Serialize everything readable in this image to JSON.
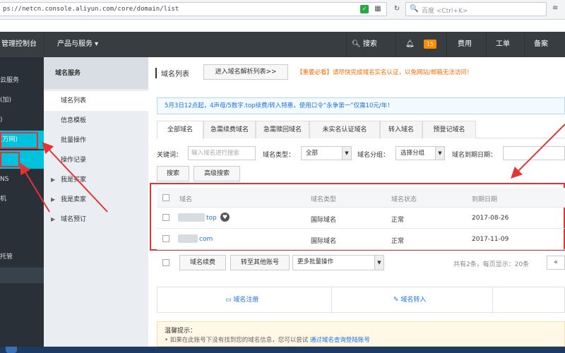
{
  "browser": {
    "url": "ps://netcn.console.aliyun.com/core/domain/list",
    "search_placeholder": "百度 <Ctrl+K>",
    "search_icon": "search-icon",
    "grid_icon": "grid-icon",
    "reload_icon": "reload-icon",
    "shield_icon": "shield-icon"
  },
  "topnav": {
    "console": "管理控制台",
    "products": "产品与服务 ▾",
    "search": "搜索",
    "badge": "15",
    "fee": "费用",
    "ticket": "工单",
    "icp": "备案"
  },
  "sidebar": {
    "items": [
      {
        "label": "云服务"
      },
      {
        "label": "(加)"
      },
      {
        "label": ")"
      },
      {
        "label": "(万网)"
      },
      {
        "label": ""
      },
      {
        "label": "NS"
      },
      {
        "label": "机"
      },
      {
        "label": "托管"
      }
    ]
  },
  "subnav": {
    "title": "域名服务",
    "items": [
      {
        "label": "域名列表"
      },
      {
        "label": "信息模板"
      },
      {
        "label": "批量操作"
      },
      {
        "label": "操作记录"
      },
      {
        "label": "我是买家"
      },
      {
        "label": "我是卖家"
      },
      {
        "label": "域名预订"
      }
    ]
  },
  "main": {
    "title": "域名列表",
    "dns_button": "进入域名解析列表>>",
    "warning": "【重要必看】请尽快完成域名实名认证，以免网站/邮箱无法访问！",
    "promo": "5月3日12点起，4声母/5数字.top续费/转入特惠，使用口令“永争第一”仅需10元/年！",
    "tabs": [
      "全部域名",
      "急需续费域名",
      "急需赎回域名",
      "未实名认证域名",
      "转入域名",
      "预登记域名"
    ],
    "filters": {
      "keyword_label": "关键词：",
      "keyword_placeholder": "输入域名进行搜索",
      "type_label": "域名类型：",
      "type_value": "全部",
      "group_label": "域名分组：",
      "group_value": "选择分组",
      "expire_label": "域名到期日期："
    },
    "search_button": "搜索",
    "advanced_button": "高级搜索",
    "table": {
      "headers": [
        "域名",
        "域名类型",
        "域名状态",
        "到期日期"
      ],
      "rows": [
        {
          "domain_suffix": "top",
          "type": "国际域名",
          "status": "正常",
          "expiry": "2017-08-26"
        },
        {
          "domain_suffix": "com",
          "type": "国际域名",
          "status": "正常",
          "expiry": "2017-11-09"
        }
      ]
    },
    "bulk": {
      "renew": "域名续费",
      "transfer": "转至其他账号",
      "more": "更多批量操作",
      "page_info": "共有2条，每页显示：20条",
      "pager": "«"
    },
    "quick": {
      "register": "域名注册",
      "transfer_in": "域名转入"
    },
    "tips": {
      "title": "温馨提示：",
      "body": "• 如果在此账号下没有找到您的域名信息，您可以尝试",
      "link": "通过域名查询登陆账号"
    }
  },
  "colors": {
    "nav_bg": "#373d41",
    "sidebar_bg": "#293038",
    "active_blue": "#00c1de",
    "annotation_red": "#e53333",
    "link_blue": "#1a73e8",
    "warning_orange": "#ff6a00"
  }
}
